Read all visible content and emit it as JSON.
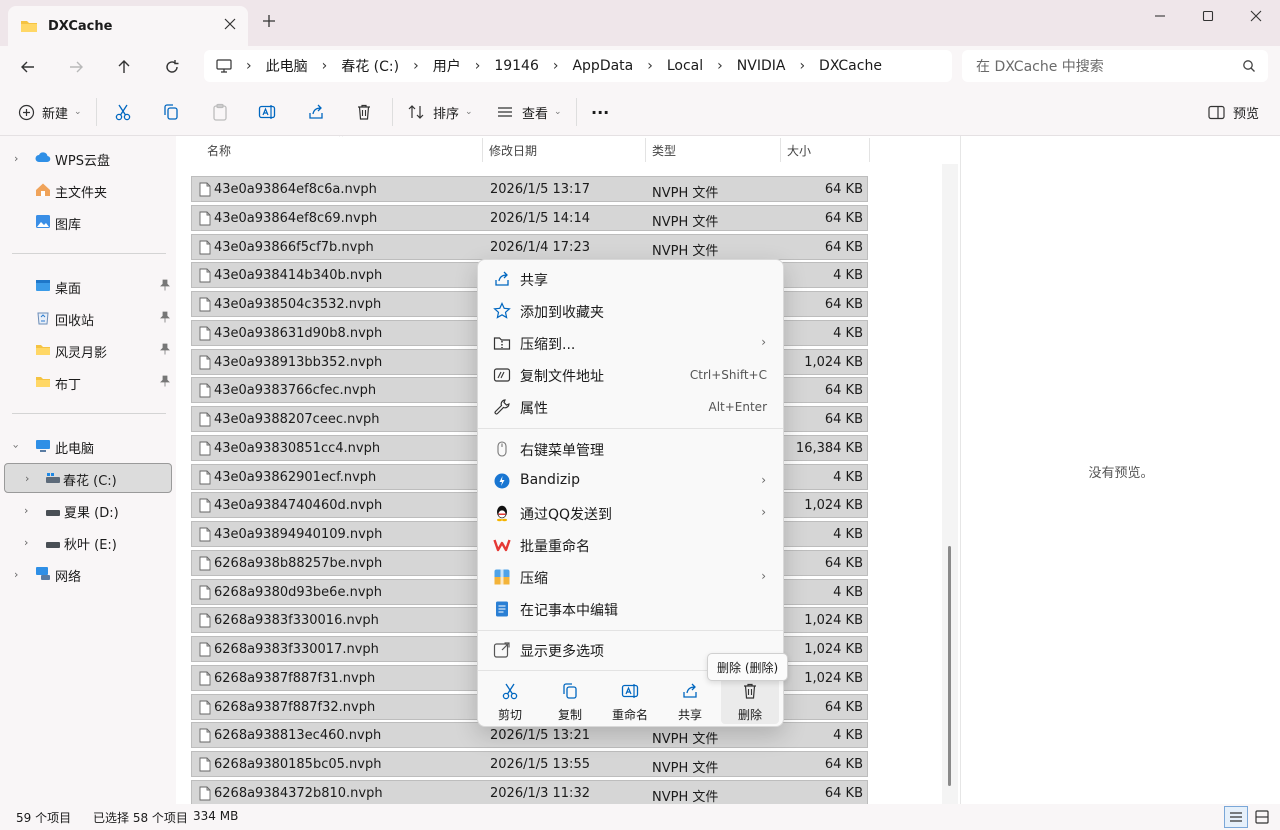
{
  "window": {
    "tab_title": "DXCache",
    "new_tab": "+"
  },
  "nav": {
    "breadcrumb": [
      "此电脑",
      "春花 (C:)",
      "用户",
      "19146",
      "AppData",
      "Local",
      "NVIDIA",
      "DXCache"
    ],
    "search_placeholder": "在 DXCache 中搜索"
  },
  "toolbar": {
    "new_label": "新建",
    "sort_label": "排序",
    "view_label": "查看",
    "more_label": "···",
    "preview_label": "预览"
  },
  "sidebar": {
    "items": [
      {
        "label": "WPS云盘",
        "icon": "cloud-icon"
      },
      {
        "label": "主文件夹",
        "icon": "home-icon"
      },
      {
        "label": "图库",
        "icon": "gallery-icon"
      },
      {
        "label": "桌面",
        "icon": "desktop-icon"
      },
      {
        "label": "回收站",
        "icon": "recycle-bin-icon"
      },
      {
        "label": "风灵月影",
        "icon": "folder-icon"
      },
      {
        "label": "布丁",
        "icon": "folder-icon"
      },
      {
        "label": "此电脑",
        "icon": "pc-icon"
      },
      {
        "label": "春花 (C:)",
        "icon": "drive-icon"
      },
      {
        "label": "夏果 (D:)",
        "icon": "drive-icon"
      },
      {
        "label": "秋叶 (E:)",
        "icon": "drive-icon"
      },
      {
        "label": "网络",
        "icon": "network-icon"
      }
    ]
  },
  "columns": {
    "name": "名称",
    "date": "修改日期",
    "type": "类型",
    "size": "大小"
  },
  "files": [
    {
      "name": "43e0a93864ef8c6a.nvph",
      "date": "2026/1/5 13:17",
      "type": "NVPH 文件",
      "size": "64 KB"
    },
    {
      "name": "43e0a93864ef8c69.nvph",
      "date": "2026/1/5 14:14",
      "type": "NVPH 文件",
      "size": "64 KB"
    },
    {
      "name": "43e0a93866f5cf7b.nvph",
      "date": "2026/1/4 17:23",
      "type": "NVPH 文件",
      "size": "64 KB"
    },
    {
      "name": "43e0a938414b340b.nvph",
      "date": "",
      "type": "",
      "size": "4 KB"
    },
    {
      "name": "43e0a938504c3532.nvph",
      "date": "",
      "type": "",
      "size": "64 KB"
    },
    {
      "name": "43e0a938631d90b8.nvph",
      "date": "",
      "type": "",
      "size": "4 KB"
    },
    {
      "name": "43e0a938913bb352.nvph",
      "date": "",
      "type": "",
      "size": "1,024 KB"
    },
    {
      "name": "43e0a9383766cfec.nvph",
      "date": "",
      "type": "",
      "size": "64 KB"
    },
    {
      "name": "43e0a9388207ceec.nvph",
      "date": "",
      "type": "",
      "size": "64 KB"
    },
    {
      "name": "43e0a93830851cc4.nvph",
      "date": "",
      "type": "",
      "size": "16,384 KB"
    },
    {
      "name": "43e0a93862901ecf.nvph",
      "date": "",
      "type": "",
      "size": "4 KB"
    },
    {
      "name": "43e0a9384740460d.nvph",
      "date": "",
      "type": "",
      "size": "1,024 KB"
    },
    {
      "name": "43e0a93894940109.nvph",
      "date": "",
      "type": "",
      "size": "4 KB"
    },
    {
      "name": "6268a938b88257be.nvph",
      "date": "",
      "type": "",
      "size": "64 KB"
    },
    {
      "name": "6268a9380d93be6e.nvph",
      "date": "",
      "type": "",
      "size": "4 KB"
    },
    {
      "name": "6268a9383f330016.nvph",
      "date": "",
      "type": "",
      "size": "1,024 KB"
    },
    {
      "name": "6268a9383f330017.nvph",
      "date": "",
      "type": "",
      "size": "1,024 KB"
    },
    {
      "name": "6268a9387f887f31.nvph",
      "date": "",
      "type": "",
      "size": "1,024 KB"
    },
    {
      "name": "6268a9387f887f32.nvph",
      "date": "",
      "type": "",
      "size": "64 KB"
    },
    {
      "name": "6268a938813ec460.nvph",
      "date": "2026/1/5 13:21",
      "type": "NVPH 文件",
      "size": "4 KB"
    },
    {
      "name": "6268a9380185bc05.nvph",
      "date": "2026/1/5 13:55",
      "type": "NVPH 文件",
      "size": "64 KB"
    },
    {
      "name": "6268a9384372b810.nvph",
      "date": "2026/1/3 11:32",
      "type": "NVPH 文件",
      "size": "64 KB"
    }
  ],
  "context_menu": {
    "items": [
      {
        "label": "共享",
        "shortcut": "",
        "arrow": ""
      },
      {
        "label": "添加到收藏夹",
        "shortcut": "",
        "arrow": ""
      },
      {
        "label": "压缩到...",
        "shortcut": "",
        "arrow": "›"
      },
      {
        "label": "复制文件地址",
        "shortcut": "Ctrl+Shift+C",
        "arrow": ""
      },
      {
        "label": "属性",
        "shortcut": "Alt+Enter",
        "arrow": ""
      },
      {
        "label": "右键菜单管理",
        "shortcut": "",
        "arrow": ""
      },
      {
        "label": "Bandizip",
        "shortcut": "",
        "arrow": "›"
      },
      {
        "label": "通过QQ发送到",
        "shortcut": "",
        "arrow": "›"
      },
      {
        "label": "批量重命名",
        "shortcut": "",
        "arrow": ""
      },
      {
        "label": "压缩",
        "shortcut": "",
        "arrow": "›"
      },
      {
        "label": "在记事本中编辑",
        "shortcut": "",
        "arrow": ""
      },
      {
        "label": "显示更多选项",
        "shortcut": "",
        "arrow": ""
      }
    ],
    "quick_actions": [
      {
        "label": "剪切"
      },
      {
        "label": "复制"
      },
      {
        "label": "重命名"
      },
      {
        "label": "共享"
      },
      {
        "label": "删除"
      }
    ],
    "tooltip": "删除 (删除)"
  },
  "preview": {
    "message": "没有预览。"
  },
  "status": {
    "count": "59 个项目",
    "selected": "已选择 58 个项目",
    "size": "334 MB"
  },
  "colors": {
    "accent": "#0067c0",
    "selection": "#d6d6d6",
    "wps_red": "#e53935"
  }
}
